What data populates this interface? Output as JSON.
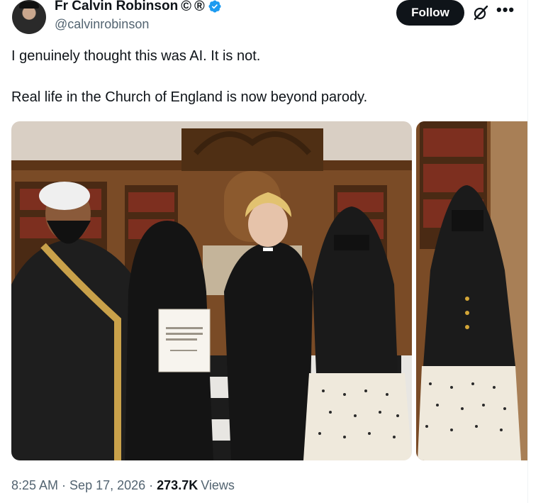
{
  "author": {
    "display_name": "Fr Calvin Robinson",
    "marks": [
      "©",
      "®"
    ],
    "handle": "@calvinrobinson",
    "verified": true
  },
  "actions": {
    "follow_label": "Follow",
    "grok_icon": "grok-icon",
    "more_icon": "more-icon"
  },
  "tweet": {
    "lines": [
      "I genuinely thought this was AI. It is not.",
      "Real life in the Church of England is now beyond parody."
    ]
  },
  "media": {
    "photo_count": 2,
    "photo_1_subject": "photo-people-holding-certificate",
    "photo_2_subject": "photo-woman-in-black-jacket",
    "certificate_text": "Ai Ahmed Mohammed"
  },
  "meta": {
    "time": "8:25 AM",
    "date": "Sep 17, 2026",
    "views_count": "273.7K",
    "views_label": "Views"
  },
  "colors": {
    "text_primary": "#0f1419",
    "text_secondary": "#536471",
    "verified_blue": "#1d9bf0",
    "follow_bg": "#0f1419"
  }
}
